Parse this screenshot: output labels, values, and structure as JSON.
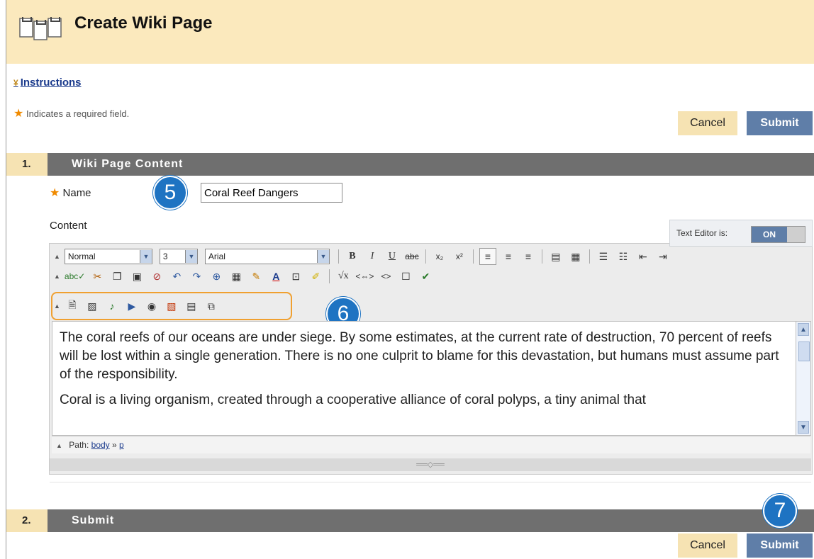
{
  "page": {
    "title": "Create Wiki Page"
  },
  "instructions": {
    "label": "Instructions"
  },
  "required_note": "Indicates a required field.",
  "buttons": {
    "cancel": "Cancel",
    "submit": "Submit"
  },
  "section1": {
    "number": "1.",
    "title": "Wiki Page Content"
  },
  "name_field": {
    "label": "Name",
    "value": "Coral Reef Dangers"
  },
  "content_label": "Content",
  "text_editor": {
    "status_label": "Text Editor is:",
    "toggle": "ON"
  },
  "toolbar": {
    "format_select": "Normal",
    "size_select": "3",
    "font_select": "Arial",
    "row1_icons": [
      "bold-icon",
      "italic-icon",
      "underline-icon",
      "strikethrough-icon",
      "subscript-icon",
      "superscript-icon",
      "align-left-icon",
      "align-center-icon",
      "align-right-icon",
      "paste-text-icon",
      "paste-word-icon",
      "ordered-list-icon",
      "unordered-list-icon",
      "outdent-icon",
      "indent-icon"
    ],
    "row2_icons": [
      "spellcheck-icon",
      "cut-icon",
      "copy-icon",
      "paste-icon",
      "remove-link-icon",
      "undo-icon",
      "redo-icon",
      "insert-link-icon",
      "insert-table-icon",
      "pencil-icon",
      "text-color-icon",
      "insert-media-icon",
      "highlight-icon",
      "math-icon",
      "html-code-icon",
      "source-code-icon",
      "fullscreen-icon",
      "preview-icon"
    ],
    "row3_icons": [
      "insert-file-icon",
      "insert-image-icon",
      "insert-audio-icon",
      "insert-video-icon",
      "flickr-mashup-icon",
      "slideshare-mashup-icon",
      "youtube-mashup-icon",
      "wiki-link-icon"
    ]
  },
  "content": {
    "paragraph1": "The coral reefs of our oceans are under siege. By some estimates, at the current rate of destruction, 70 percent of reefs will be lost within a single generation. There is no one culprit to blame for this devastation, but humans must assume part of the responsibility.",
    "paragraph2": "Coral is a living organism, created through a cooperative alliance of coral polyps, a tiny animal that"
  },
  "path_bar": {
    "label": "Path:",
    "crumbs": [
      "body",
      "p"
    ],
    "separator": "»"
  },
  "callouts": {
    "c5": "5",
    "c6": "6",
    "c7": "7"
  },
  "section2": {
    "number": "2.",
    "title": "Submit"
  },
  "colors": {
    "header_bg": "#fbe9bd",
    "section_bar": "#6f6f6f",
    "submit_bg": "#5f7ea8",
    "callout": "#1e73c2",
    "highlight_box": "#f0a030"
  }
}
